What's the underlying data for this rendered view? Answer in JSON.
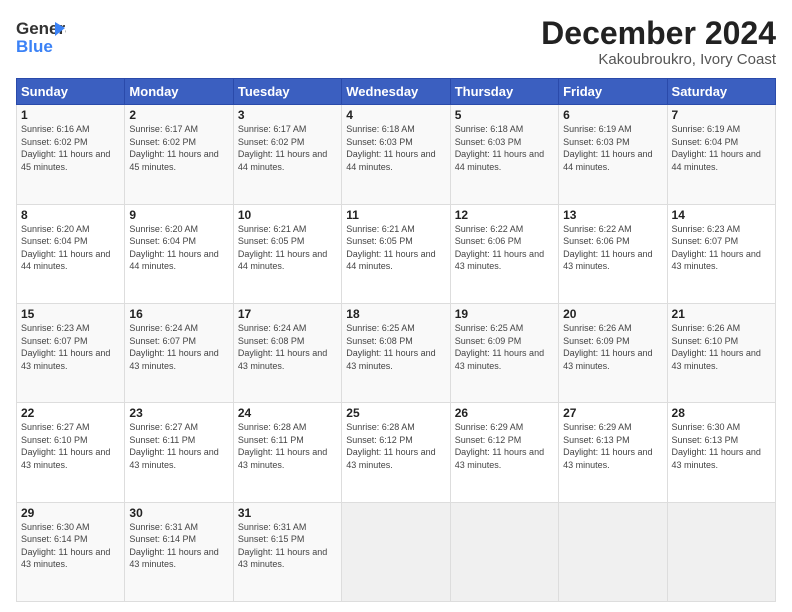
{
  "header": {
    "logo_line1": "General",
    "logo_line2": "Blue",
    "month_year": "December 2024",
    "location": "Kakoubroukro, Ivory Coast"
  },
  "days_of_week": [
    "Sunday",
    "Monday",
    "Tuesday",
    "Wednesday",
    "Thursday",
    "Friday",
    "Saturday"
  ],
  "weeks": [
    [
      {
        "day": "1",
        "info": "Sunrise: 6:16 AM\nSunset: 6:02 PM\nDaylight: 11 hours and 45 minutes."
      },
      {
        "day": "2",
        "info": "Sunrise: 6:17 AM\nSunset: 6:02 PM\nDaylight: 11 hours and 45 minutes."
      },
      {
        "day": "3",
        "info": "Sunrise: 6:17 AM\nSunset: 6:02 PM\nDaylight: 11 hours and 44 minutes."
      },
      {
        "day": "4",
        "info": "Sunrise: 6:18 AM\nSunset: 6:03 PM\nDaylight: 11 hours and 44 minutes."
      },
      {
        "day": "5",
        "info": "Sunrise: 6:18 AM\nSunset: 6:03 PM\nDaylight: 11 hours and 44 minutes."
      },
      {
        "day": "6",
        "info": "Sunrise: 6:19 AM\nSunset: 6:03 PM\nDaylight: 11 hours and 44 minutes."
      },
      {
        "day": "7",
        "info": "Sunrise: 6:19 AM\nSunset: 6:04 PM\nDaylight: 11 hours and 44 minutes."
      }
    ],
    [
      {
        "day": "8",
        "info": "Sunrise: 6:20 AM\nSunset: 6:04 PM\nDaylight: 11 hours and 44 minutes."
      },
      {
        "day": "9",
        "info": "Sunrise: 6:20 AM\nSunset: 6:04 PM\nDaylight: 11 hours and 44 minutes."
      },
      {
        "day": "10",
        "info": "Sunrise: 6:21 AM\nSunset: 6:05 PM\nDaylight: 11 hours and 44 minutes."
      },
      {
        "day": "11",
        "info": "Sunrise: 6:21 AM\nSunset: 6:05 PM\nDaylight: 11 hours and 44 minutes."
      },
      {
        "day": "12",
        "info": "Sunrise: 6:22 AM\nSunset: 6:06 PM\nDaylight: 11 hours and 43 minutes."
      },
      {
        "day": "13",
        "info": "Sunrise: 6:22 AM\nSunset: 6:06 PM\nDaylight: 11 hours and 43 minutes."
      },
      {
        "day": "14",
        "info": "Sunrise: 6:23 AM\nSunset: 6:07 PM\nDaylight: 11 hours and 43 minutes."
      }
    ],
    [
      {
        "day": "15",
        "info": "Sunrise: 6:23 AM\nSunset: 6:07 PM\nDaylight: 11 hours and 43 minutes."
      },
      {
        "day": "16",
        "info": "Sunrise: 6:24 AM\nSunset: 6:07 PM\nDaylight: 11 hours and 43 minutes."
      },
      {
        "day": "17",
        "info": "Sunrise: 6:24 AM\nSunset: 6:08 PM\nDaylight: 11 hours and 43 minutes."
      },
      {
        "day": "18",
        "info": "Sunrise: 6:25 AM\nSunset: 6:08 PM\nDaylight: 11 hours and 43 minutes."
      },
      {
        "day": "19",
        "info": "Sunrise: 6:25 AM\nSunset: 6:09 PM\nDaylight: 11 hours and 43 minutes."
      },
      {
        "day": "20",
        "info": "Sunrise: 6:26 AM\nSunset: 6:09 PM\nDaylight: 11 hours and 43 minutes."
      },
      {
        "day": "21",
        "info": "Sunrise: 6:26 AM\nSunset: 6:10 PM\nDaylight: 11 hours and 43 minutes."
      }
    ],
    [
      {
        "day": "22",
        "info": "Sunrise: 6:27 AM\nSunset: 6:10 PM\nDaylight: 11 hours and 43 minutes."
      },
      {
        "day": "23",
        "info": "Sunrise: 6:27 AM\nSunset: 6:11 PM\nDaylight: 11 hours and 43 minutes."
      },
      {
        "day": "24",
        "info": "Sunrise: 6:28 AM\nSunset: 6:11 PM\nDaylight: 11 hours and 43 minutes."
      },
      {
        "day": "25",
        "info": "Sunrise: 6:28 AM\nSunset: 6:12 PM\nDaylight: 11 hours and 43 minutes."
      },
      {
        "day": "26",
        "info": "Sunrise: 6:29 AM\nSunset: 6:12 PM\nDaylight: 11 hours and 43 minutes."
      },
      {
        "day": "27",
        "info": "Sunrise: 6:29 AM\nSunset: 6:13 PM\nDaylight: 11 hours and 43 minutes."
      },
      {
        "day": "28",
        "info": "Sunrise: 6:30 AM\nSunset: 6:13 PM\nDaylight: 11 hours and 43 minutes."
      }
    ],
    [
      {
        "day": "29",
        "info": "Sunrise: 6:30 AM\nSunset: 6:14 PM\nDaylight: 11 hours and 43 minutes."
      },
      {
        "day": "30",
        "info": "Sunrise: 6:31 AM\nSunset: 6:14 PM\nDaylight: 11 hours and 43 minutes."
      },
      {
        "day": "31",
        "info": "Sunrise: 6:31 AM\nSunset: 6:15 PM\nDaylight: 11 hours and 43 minutes."
      },
      null,
      null,
      null,
      null
    ]
  ]
}
